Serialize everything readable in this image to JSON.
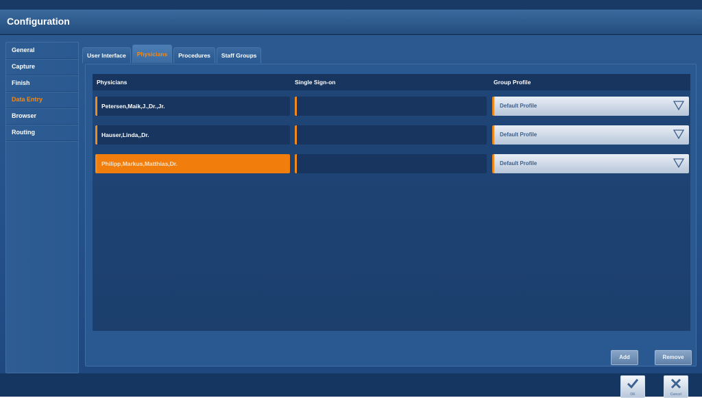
{
  "window": {
    "title": "Configuration"
  },
  "sidebar": {
    "items": [
      {
        "label": "General"
      },
      {
        "label": "Capture"
      },
      {
        "label": "Finish"
      },
      {
        "label": "Data Entry",
        "active": true
      },
      {
        "label": "Browser"
      },
      {
        "label": "Routing"
      }
    ]
  },
  "tabs": [
    {
      "label": "User Interface"
    },
    {
      "label": "Physicians",
      "active": true
    },
    {
      "label": "Procedures"
    },
    {
      "label": "Staff Groups"
    }
  ],
  "table": {
    "columns": [
      "Physicians",
      "Single Sign-on",
      "Group Profile"
    ],
    "rows": [
      {
        "physician": "Petersen,Maik,J.,Dr.,Jr.",
        "sso": "",
        "profile": "Default Profile"
      },
      {
        "physician": "Hauser,Linda,,Dr.",
        "sso": "",
        "profile": "Default Profile"
      },
      {
        "physician": "Philipp,Markus,Matthias,Dr.",
        "sso": "",
        "profile": "Default Profile",
        "selected": true
      }
    ]
  },
  "actions": {
    "add_label": "Add",
    "remove_label": "Remove"
  },
  "footer": {
    "ok_label": "OK",
    "cancel_label": "Cancel"
  },
  "icons": {
    "dropdown": "chevron-down-icon",
    "ok": "check-icon",
    "cancel": "close-icon"
  },
  "colors": {
    "accent": "#f08a1c",
    "selected_row": "#f07d0c",
    "background": "#24508a"
  }
}
